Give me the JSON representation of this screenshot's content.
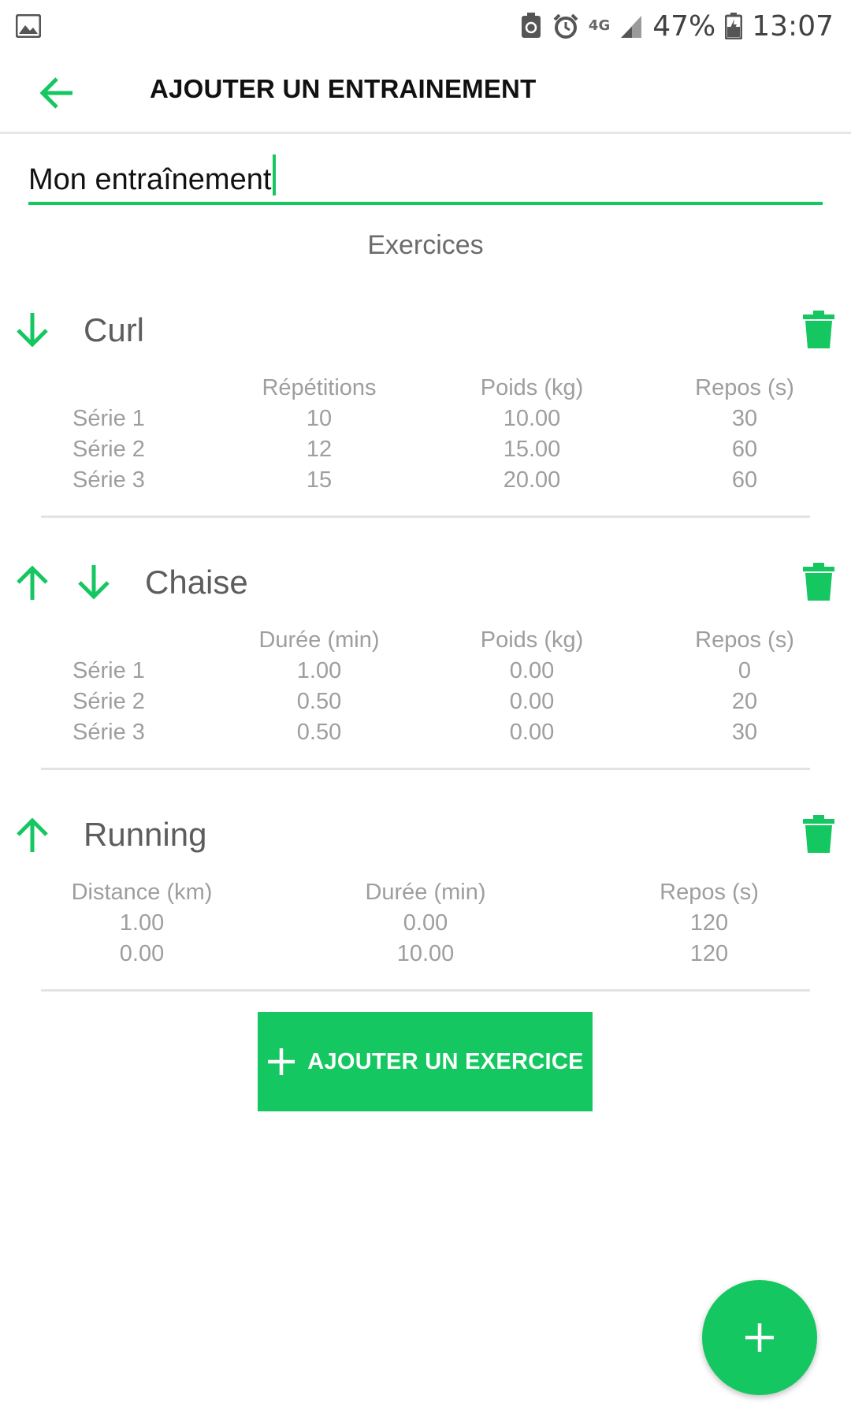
{
  "status_bar": {
    "battery": "47%",
    "time": "13:07",
    "network": "4G",
    "icons": [
      "gallery-icon",
      "sync-icon",
      "alarm-icon",
      "network-4g-icon",
      "signal-icon",
      "battery-charging-icon"
    ]
  },
  "app_bar": {
    "title": "AJOUTER UN ENTRAINEMENT",
    "back_icon": "arrow-left-icon"
  },
  "workout_name": {
    "value": "Mon entraînement"
  },
  "section_label": "Exercices",
  "exercises": [
    {
      "name": "Curl",
      "columns": [
        "Répétitions",
        "Poids (kg)",
        "Repos (s)"
      ],
      "rows": [
        {
          "label": "Série 1",
          "values": [
            "10",
            "10.00",
            "30"
          ]
        },
        {
          "label": "Série 2",
          "values": [
            "12",
            "15.00",
            "60"
          ]
        },
        {
          "label": "Série 3",
          "values": [
            "15",
            "20.00",
            "60"
          ]
        }
      ]
    },
    {
      "name": "Chaise",
      "columns": [
        "Durée (min)",
        "Poids (kg)",
        "Repos (s)"
      ],
      "rows": [
        {
          "label": "Série 1",
          "values": [
            "1.00",
            "0.00",
            "0"
          ]
        },
        {
          "label": "Série 2",
          "values": [
            "0.50",
            "0.00",
            "20"
          ]
        },
        {
          "label": "Série 3",
          "values": [
            "0.50",
            "0.00",
            "30"
          ]
        }
      ]
    },
    {
      "name": "Running",
      "columns": [
        "Distance (km)",
        "Durée (min)",
        "Repos (s)"
      ],
      "rows": [
        {
          "values": [
            "1.00",
            "0.00",
            "120"
          ]
        },
        {
          "values": [
            "0.00",
            "10.00",
            "120"
          ]
        }
      ]
    }
  ],
  "add_exercise_button": {
    "label": "AJOUTER UN EXERCICE",
    "icon": "plus-icon"
  },
  "fab": {
    "icon": "plus-icon"
  },
  "colors": {
    "accent": "#15c760",
    "text_primary": "#111111",
    "text_secondary": "#9e9e9e",
    "divider": "#e3e3e3"
  }
}
